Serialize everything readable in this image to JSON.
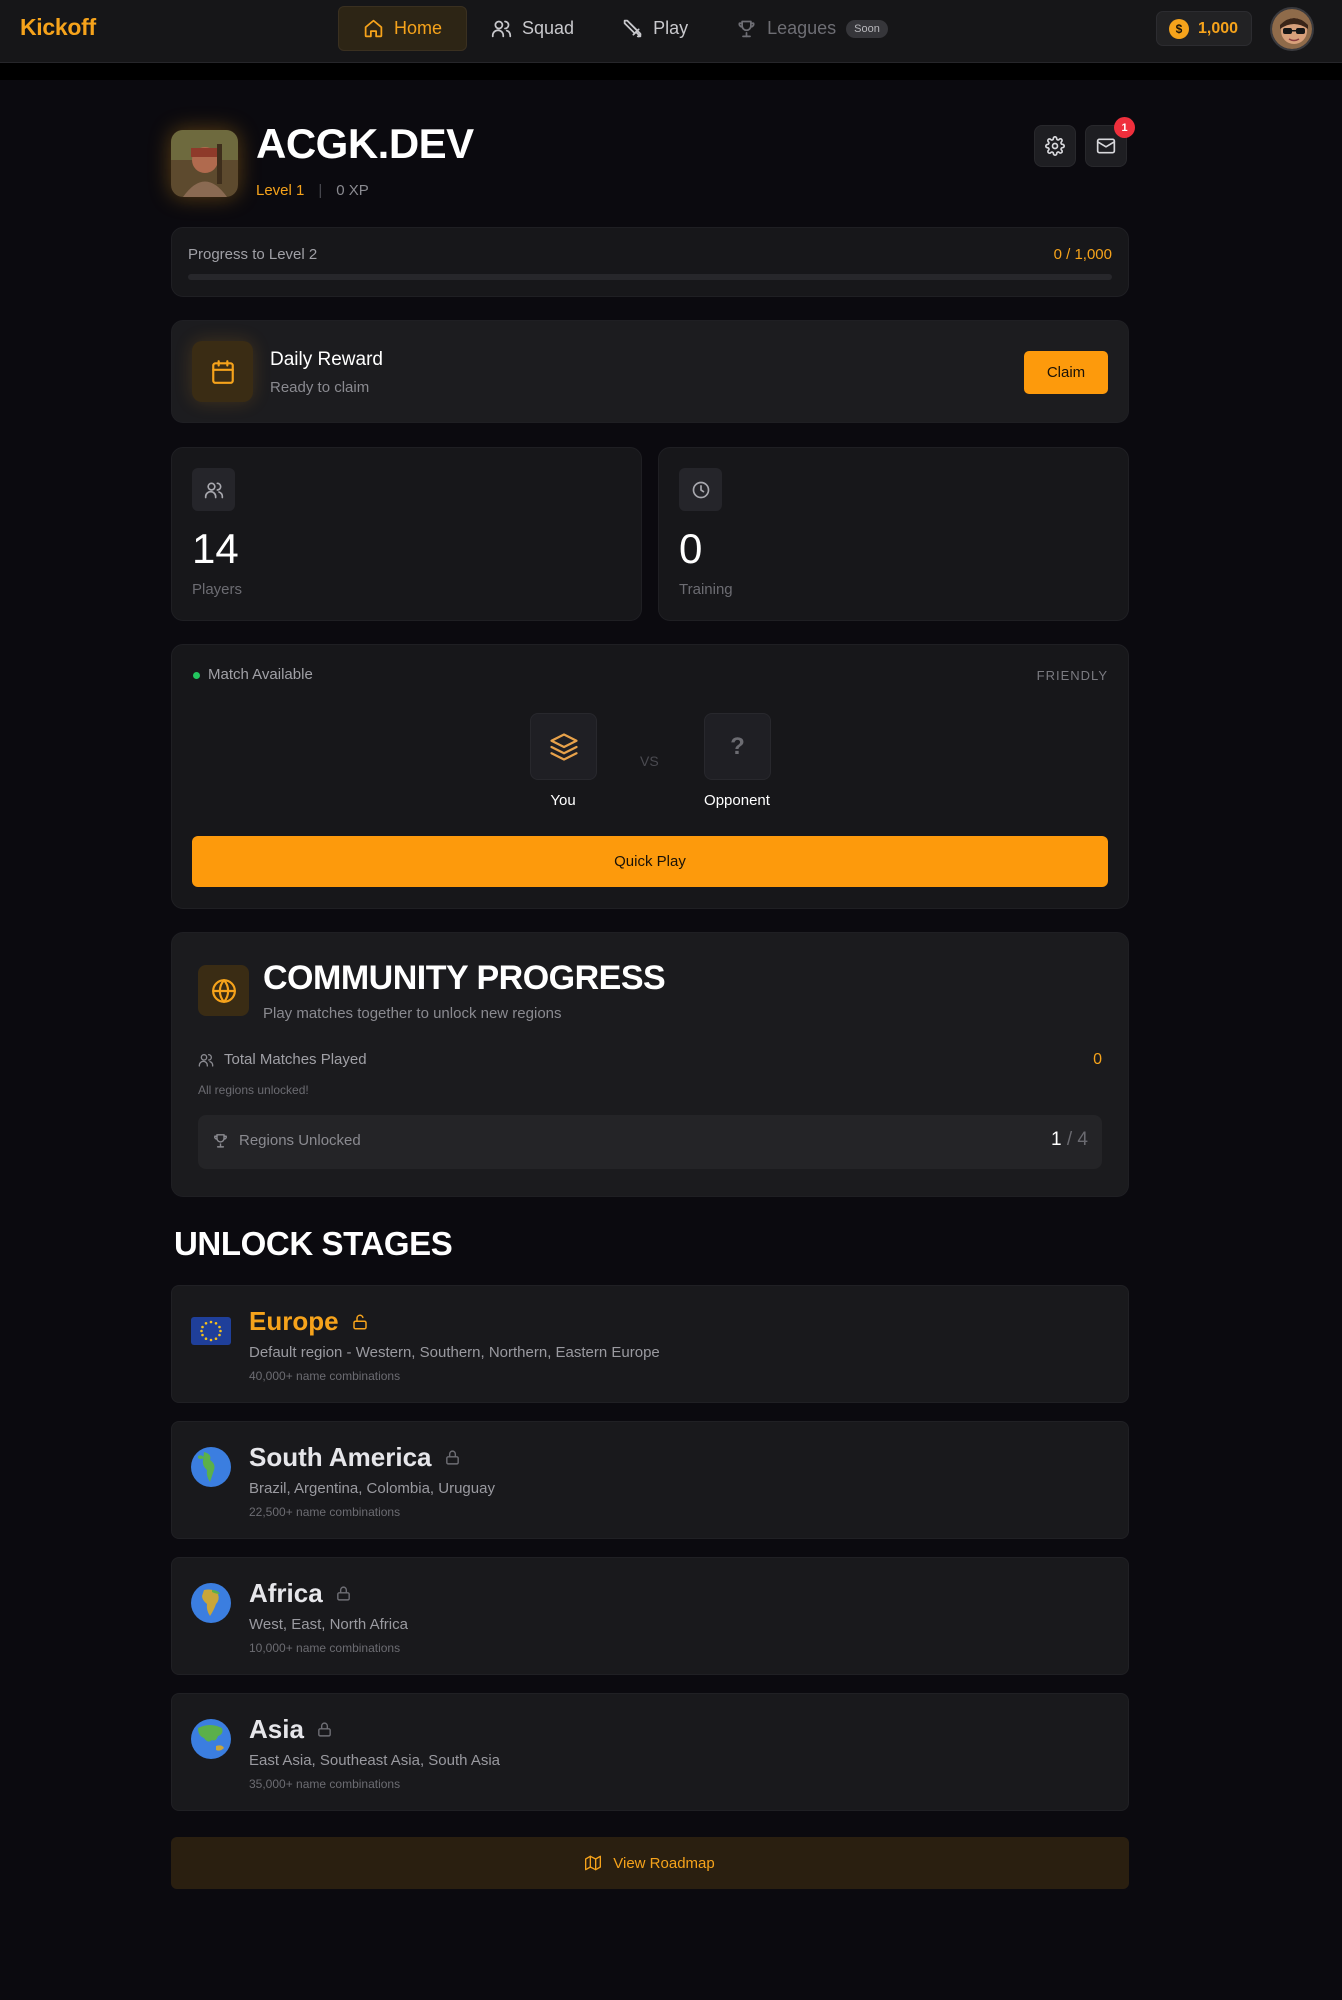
{
  "app": {
    "logo": "Kickoff"
  },
  "nav": {
    "tabs": [
      {
        "label": "Home",
        "icon": "home-icon",
        "active": true
      },
      {
        "label": "Squad",
        "icon": "users-icon"
      },
      {
        "label": "Play",
        "icon": "swords-icon"
      },
      {
        "label": "Leagues",
        "icon": "trophy-icon",
        "badge": "Soon",
        "disabled": true
      }
    ],
    "coins": "1,000",
    "coin_symbol": "$"
  },
  "profile": {
    "name": "ACGK.DEV",
    "level": "Level 1",
    "divider": "|",
    "xp": "0 XP",
    "notification_count": "1"
  },
  "progress": {
    "label": "Progress to Level 2",
    "value": "0 / 1,000",
    "fraction": 0
  },
  "daily_reward": {
    "title": "Daily Reward",
    "subtitle": "Ready to claim",
    "button": "Claim"
  },
  "stats": [
    {
      "value": "14",
      "label": "Players",
      "icon": "users-icon"
    },
    {
      "value": "0",
      "label": "Training",
      "icon": "clock-icon"
    }
  ],
  "match": {
    "status": "Match Available",
    "type": "FRIENDLY",
    "you": "You",
    "vs": "VS",
    "opponent": "Opponent",
    "opponent_mark": "?",
    "button": "Quick Play"
  },
  "community": {
    "title": "COMMUNITY PROGRESS",
    "subtitle": "Play matches together to unlock new regions",
    "total_label": "Total Matches Played",
    "total_value": "0",
    "note": "All regions unlocked!",
    "regions_label": "Regions Unlocked",
    "regions_unlocked": "1",
    "regions_separator": "/",
    "regions_total": "4"
  },
  "stages": {
    "title": "UNLOCK STAGES",
    "items": [
      {
        "name": "Europe",
        "desc": "Default region - Western, Southern, Northern, Eastern Europe",
        "count": "40,000+ name combinations",
        "unlocked": true,
        "flag": "eu-flag-icon"
      },
      {
        "name": "South America",
        "desc": "Brazil, Argentina, Colombia, Uruguay",
        "count": "22,500+ name combinations",
        "unlocked": false,
        "flag": "globe-americas-icon"
      },
      {
        "name": "Africa",
        "desc": "West, East, North Africa",
        "count": "10,000+ name combinations",
        "unlocked": false,
        "flag": "globe-africa-icon"
      },
      {
        "name": "Asia",
        "desc": "East Asia, Southeast Asia, South Asia",
        "count": "35,000+ name combinations",
        "unlocked": false,
        "flag": "globe-asia-icon"
      }
    ]
  },
  "roadmap": {
    "button": "View Roadmap"
  },
  "colors": {
    "accent": "#f6a31b",
    "button": "#fd9a0c",
    "background": "#0b0a0f",
    "card": "#17171a",
    "notification": "#ef2f3c",
    "status_dot": "#22c55e"
  }
}
